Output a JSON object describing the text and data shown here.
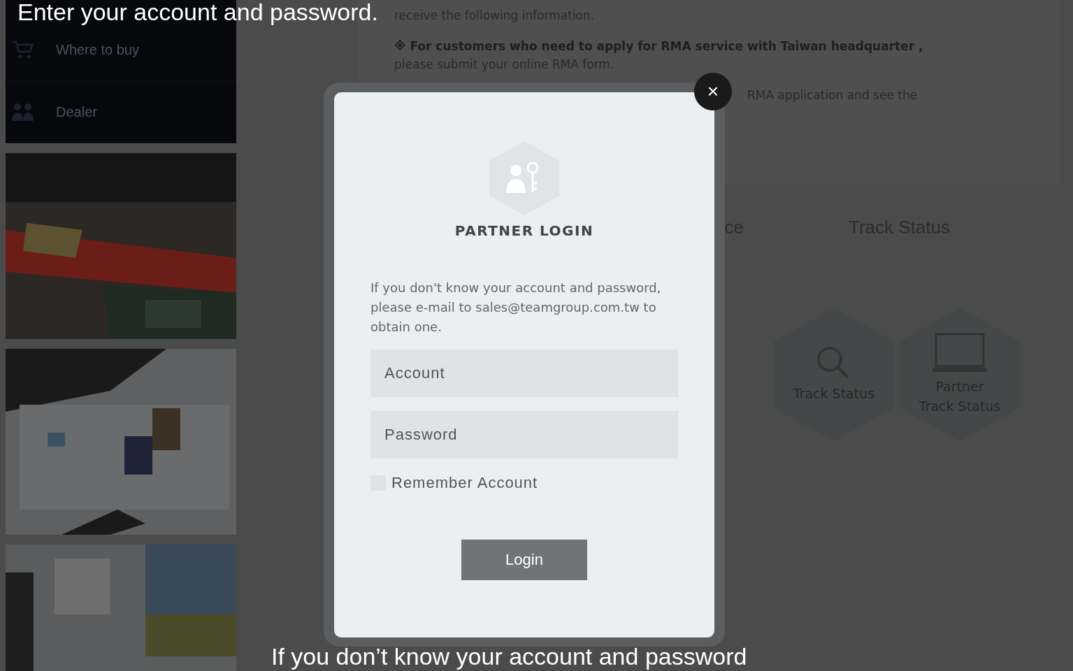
{
  "captions": {
    "top": "Enter your account and password.",
    "bottom": "If you don’t know your account and password"
  },
  "sidebar": {
    "menu": [
      {
        "label": "Where to buy"
      },
      {
        "label": "Dealer"
      }
    ]
  },
  "content": {
    "lines": [
      {
        "kind": "plain",
        "text": "receive the following information."
      },
      {
        "kind": "bold",
        "text": "※ For customers who need to apply for RMA service with Taiwan headquarter ,"
      },
      {
        "kind": "plain",
        "text": "please submit your online RMA form."
      },
      {
        "kind": "plain",
        "text": "RMA application and see the"
      }
    ],
    "tabs": [
      {
        "label": "ce"
      },
      {
        "label": "Track Status"
      }
    ],
    "tiles": [
      {
        "label": "Track Status"
      },
      {
        "label": "Partner\nTrack Status"
      }
    ]
  },
  "modal": {
    "title": "PARTNER LOGIN",
    "note": "If you don't know your account and password, please e-mail to sales@teamgroup.com.tw to obtain one.",
    "fields": [
      {
        "placeholder": "Account"
      },
      {
        "placeholder": "Password"
      }
    ],
    "remember": {
      "label": "Remember Account",
      "checked": false
    },
    "button": "Login",
    "close": "×"
  }
}
